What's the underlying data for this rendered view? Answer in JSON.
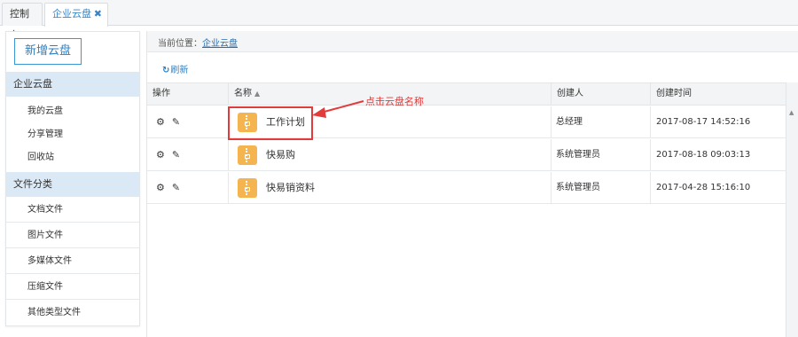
{
  "tabs": [
    {
      "label": "控制台"
    },
    {
      "label": "企业云盘",
      "close": "✖"
    }
  ],
  "sidebar": {
    "add_button": "新增云盘",
    "group1": {
      "title": "企业云盘",
      "items": [
        "我的云盘",
        "分享管理",
        "回收站"
      ]
    },
    "group2": {
      "title": "文件分类",
      "items": [
        "文档文件",
        "图片文件",
        "多媒体文件",
        "压缩文件",
        "其他类型文件"
      ]
    }
  },
  "breadcrumb": {
    "prefix": "当前位置：",
    "link": "企业云盘"
  },
  "toolbar": {
    "refresh_icon": "↻",
    "refresh": "刷新"
  },
  "table": {
    "headers": [
      "操作",
      "名称",
      "创建人",
      "创建时间"
    ],
    "sort_icon": "▲",
    "rows": [
      {
        "name": "工作计划",
        "creator": "总经理",
        "time": "2017-08-17 14:52:16"
      },
      {
        "name": "快易购",
        "creator": "系统管理员",
        "time": "2017-08-18 09:03:13"
      },
      {
        "name": "快易销资料",
        "creator": "系统管理员",
        "time": "2017-04-28 15:16:10"
      }
    ]
  },
  "annotation": {
    "text": "点击云盘名称",
    "color": "#e23b3b"
  },
  "icons": {
    "gear": "⚙",
    "pencil": "✎",
    "scroll_up": "▲"
  },
  "colors": {
    "accent": "#2b80c4",
    "folder": "#f4b551",
    "group_bg": "#dbe9f6"
  }
}
